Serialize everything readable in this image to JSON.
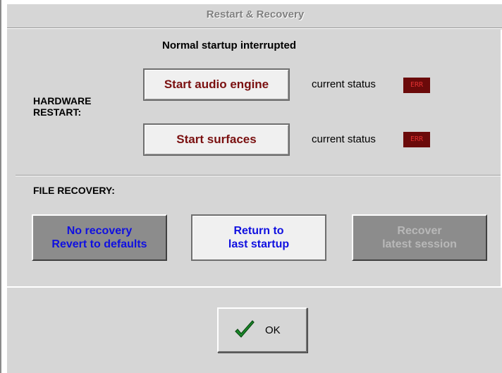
{
  "dialog": {
    "title": "Restart & Recovery",
    "subtitle": "Normal startup interrupted"
  },
  "hardware": {
    "label_line1": "HARDWARE",
    "label_line2": "RESTART:",
    "audio_button": "Start audio engine",
    "surfaces_button": "Start surfaces",
    "status_label": "current status",
    "audio_status": "ERR",
    "surfaces_status": "ERR"
  },
  "file_recovery": {
    "label": "FILE RECOVERY:",
    "no_recovery": {
      "line1": "No recovery",
      "line2": "Revert to defaults"
    },
    "return": {
      "line1": "Return to",
      "line2": "last startup"
    },
    "recover": {
      "line1": "Recover",
      "line2": "latest session"
    }
  },
  "ok_button": {
    "label": "OK",
    "icon": "checkmark-icon"
  },
  "colors": {
    "accent_blue": "#1010e0",
    "button_red": "#7a1010",
    "err_bg": "#6b0a0a",
    "dialog_bg": "#d6d6d6"
  }
}
